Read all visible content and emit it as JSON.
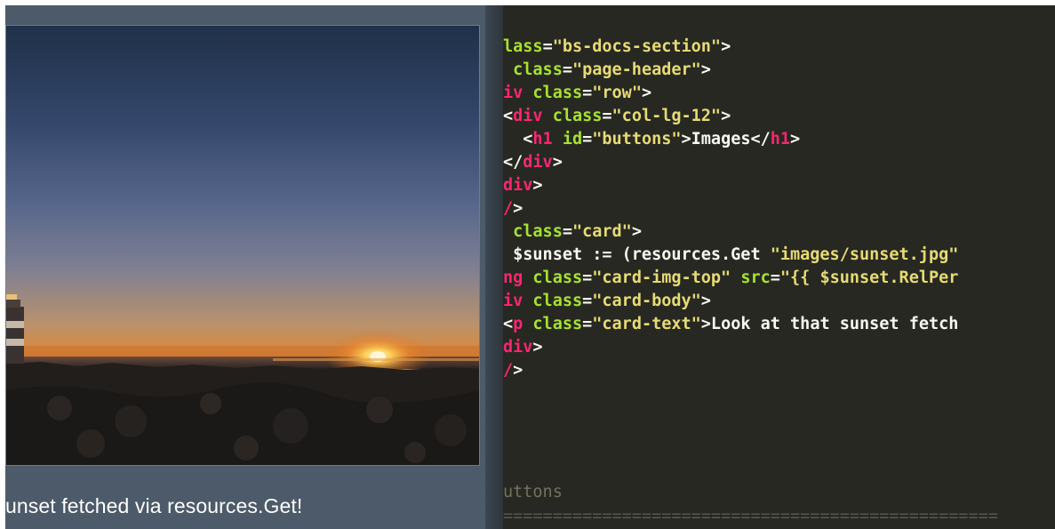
{
  "preview": {
    "caption": "unset fetched via resources.Get!"
  },
  "editor": {
    "lines": [
      [
        {
          "t": "lass",
          "c": "green"
        },
        {
          "t": "=",
          "c": "white"
        },
        {
          "t": "\"bs-docs-section\"",
          "c": "yellow"
        },
        {
          "t": ">",
          "c": "white"
        }
      ],
      [
        {
          "t": " ",
          "c": "white"
        },
        {
          "t": "class",
          "c": "green"
        },
        {
          "t": "=",
          "c": "white"
        },
        {
          "t": "\"page-header\"",
          "c": "yellow"
        },
        {
          "t": ">",
          "c": "white"
        }
      ],
      [
        {
          "t": "iv",
          "c": "pink"
        },
        {
          "t": " ",
          "c": "white"
        },
        {
          "t": "class",
          "c": "green"
        },
        {
          "t": "=",
          "c": "white"
        },
        {
          "t": "\"row\"",
          "c": "yellow"
        },
        {
          "t": ">",
          "c": "white"
        }
      ],
      [
        {
          "t": "<",
          "c": "white"
        },
        {
          "t": "div",
          "c": "pink"
        },
        {
          "t": " ",
          "c": "white"
        },
        {
          "t": "class",
          "c": "green"
        },
        {
          "t": "=",
          "c": "white"
        },
        {
          "t": "\"col-lg-12\"",
          "c": "yellow"
        },
        {
          "t": ">",
          "c": "white"
        }
      ],
      [
        {
          "t": "  <",
          "c": "white"
        },
        {
          "t": "h1",
          "c": "pink"
        },
        {
          "t": " ",
          "c": "white"
        },
        {
          "t": "id",
          "c": "green"
        },
        {
          "t": "=",
          "c": "white"
        },
        {
          "t": "\"buttons\"",
          "c": "yellow"
        },
        {
          "t": ">Images</",
          "c": "white"
        },
        {
          "t": "h1",
          "c": "pink"
        },
        {
          "t": ">",
          "c": "white"
        }
      ],
      [
        {
          "t": "</",
          "c": "white"
        },
        {
          "t": "div",
          "c": "pink"
        },
        {
          "t": ">",
          "c": "white"
        }
      ],
      [
        {
          "t": "div",
          "c": "pink"
        },
        {
          "t": ">",
          "c": "white"
        }
      ],
      [
        {
          "t": "/",
          "c": "pink"
        },
        {
          "t": ">",
          "c": "white"
        }
      ],
      [
        {
          "t": " ",
          "c": "white"
        },
        {
          "t": "class",
          "c": "green"
        },
        {
          "t": "=",
          "c": "white"
        },
        {
          "t": "\"card\"",
          "c": "yellow"
        },
        {
          "t": ">",
          "c": "white"
        }
      ],
      [
        {
          "t": " $sunset := (resources.Get ",
          "c": "white"
        },
        {
          "t": "\"images/sunset.jpg\"",
          "c": "yellow"
        }
      ],
      [
        {
          "t": "ng",
          "c": "pink"
        },
        {
          "t": " ",
          "c": "white"
        },
        {
          "t": "class",
          "c": "green"
        },
        {
          "t": "=",
          "c": "white"
        },
        {
          "t": "\"card-img-top\"",
          "c": "yellow"
        },
        {
          "t": " ",
          "c": "white"
        },
        {
          "t": "src",
          "c": "green"
        },
        {
          "t": "=",
          "c": "white"
        },
        {
          "t": "\"{{ $sunset.RelPer",
          "c": "yellow"
        }
      ],
      [
        {
          "t": "iv",
          "c": "pink"
        },
        {
          "t": " ",
          "c": "white"
        },
        {
          "t": "class",
          "c": "green"
        },
        {
          "t": "=",
          "c": "white"
        },
        {
          "t": "\"card-body\"",
          "c": "yellow"
        },
        {
          "t": ">",
          "c": "white"
        }
      ],
      [
        {
          "t": "<",
          "c": "white"
        },
        {
          "t": "p",
          "c": "pink"
        },
        {
          "t": " ",
          "c": "white"
        },
        {
          "t": "class",
          "c": "green"
        },
        {
          "t": "=",
          "c": "white"
        },
        {
          "t": "\"card-text\"",
          "c": "yellow"
        },
        {
          "t": ">Look at that sunset fetch",
          "c": "white"
        }
      ],
      [
        {
          "t": "div",
          "c": "pink"
        },
        {
          "t": ">",
          "c": "white"
        }
      ],
      [
        {
          "t": "/",
          "c": "pink"
        },
        {
          "t": ">",
          "c": "white"
        }
      ]
    ],
    "comment_line": "uttons",
    "rule_line": "=================================================="
  }
}
